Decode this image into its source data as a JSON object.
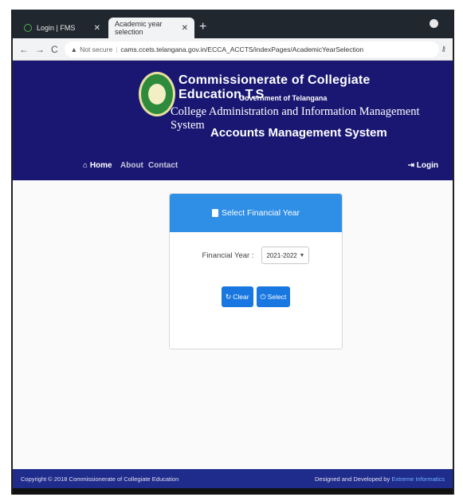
{
  "browser": {
    "tabs": [
      {
        "label": "Login | FMS",
        "active": false
      },
      {
        "label": "Academic year selection",
        "active": true
      }
    ],
    "address": {
      "security": "Not secure",
      "url": "cams.ccets.telangana.gov.in/ECCA_ACCTS/indexPages/AcademicYearSelection"
    }
  },
  "header": {
    "title": "Commissionerate of Collegiate Education,T.S",
    "government": "Government of Telangana",
    "system": "College Administration and Information Management System",
    "subsystem": "Accounts Management System"
  },
  "nav": {
    "home": "Home",
    "about": "About",
    "contact": "Contact",
    "login": "Login"
  },
  "panel": {
    "heading": "Select Financial Year",
    "field_label": "Financial Year :",
    "selected_year": "2021-2022",
    "clear_label": "Clear",
    "select_label": "Select"
  },
  "footer": {
    "copyright": "Copyright © 2018 Commissionerate of Collegiate Education",
    "designed_by": "Designed and Developed by",
    "developer": "Extreme Informatics"
  },
  "colors": {
    "header_bg": "#1a1773",
    "panel_head": "#2f8ee6",
    "button": "#1877e0",
    "footer_bg": "#1f2c8c"
  }
}
